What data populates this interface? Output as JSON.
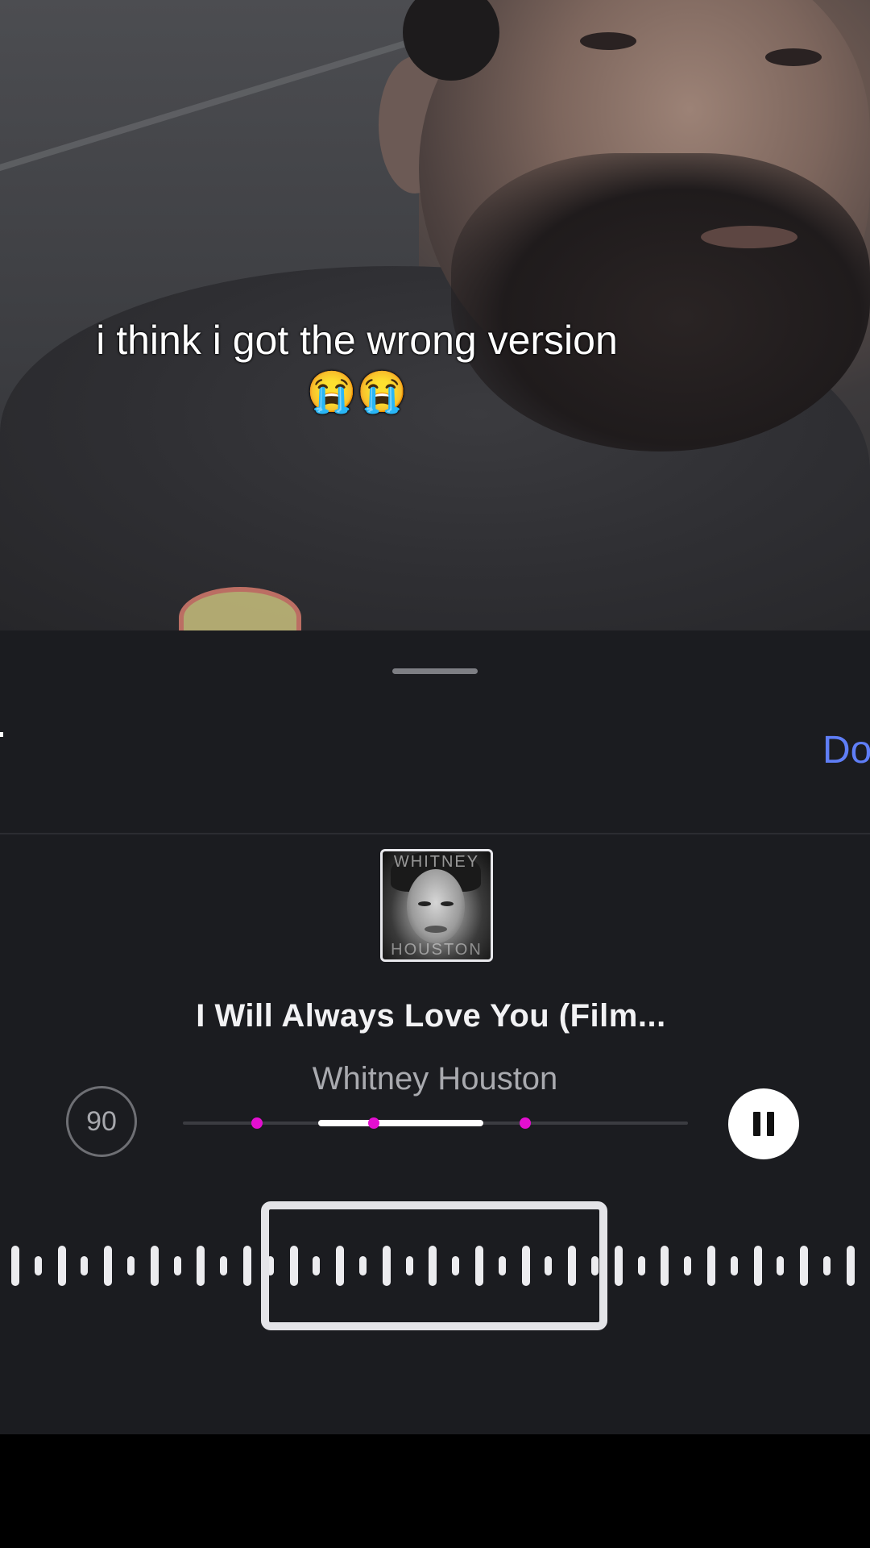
{
  "video": {
    "caption_line1": "i think i got the wrong version",
    "caption_emoji": "😭😭"
  },
  "editor": {
    "done_label": "Do",
    "bpm": "90",
    "now_playing": {
      "title": "I Will Always Love You (Film...",
      "artist": "Whitney Houston",
      "art_text_top": "WHITNEY",
      "art_text_bottom": "HOUSTON"
    },
    "icons": {
      "play_state": "pause-icon",
      "drag": "drag-handle"
    },
    "colors": {
      "accent_link": "#5f7ef7",
      "marker": "#e30fd0",
      "sheet_bg": "#1b1c20"
    }
  }
}
